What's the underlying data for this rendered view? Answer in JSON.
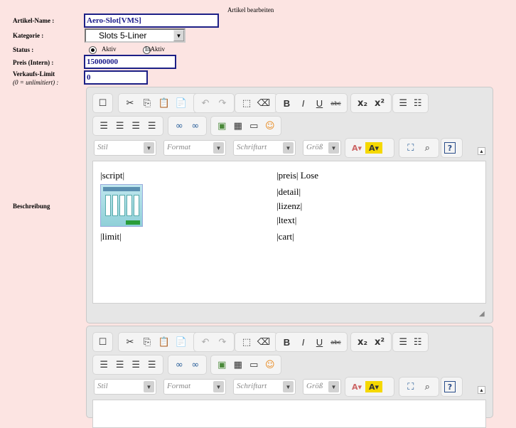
{
  "page": {
    "heading": "Artikel bearbeiten"
  },
  "form": {
    "name_label": "Artikel-Name :",
    "name_value": "Aero-Slot[VMS]",
    "category_label": "Kategorie :",
    "category_value": "Slots 5-Liner",
    "status_label": "Status :",
    "status_options": [
      {
        "label": "Aktiv",
        "selected": true
      },
      {
        "label": "InAktiv",
        "selected": false
      }
    ],
    "price_label": "Preis (Intern) :",
    "price_value": "15000000",
    "limit_label": "Verkaufs-Limit",
    "limit_sub": "(0 = unlimitiert) :",
    "limit_value": "0",
    "description_label": "Beschreibung"
  },
  "editor": {
    "format_placeholders": [
      "Stil",
      "Format",
      "Schriftart",
      "Größ"
    ],
    "content": {
      "left": [
        "|script|",
        "|limit|"
      ],
      "right": [
        "|preis| Lose",
        "|detail|",
        "|lizenz|",
        "|ltext|",
        "|cart|"
      ]
    }
  },
  "icons": {
    "toolbar1": [
      "new-page-icon",
      "cut-icon",
      "copy-icon",
      "paste-icon",
      "paste-word-icon",
      "undo-icon",
      "redo-icon",
      "select-all-icon",
      "remove-format-icon",
      "bold-icon",
      "italic-icon",
      "underline-icon",
      "strikethrough-icon",
      "subscript-icon",
      "superscript-icon",
      "numbered-list-icon",
      "bulleted-list-icon"
    ],
    "toolbar2": [
      "align-left-icon",
      "align-center-icon",
      "align-right-icon",
      "justify-icon",
      "link-icon",
      "unlink-icon",
      "image-icon",
      "table-icon",
      "horizontal-rule-icon",
      "smiley-icon"
    ],
    "toolbar3": [
      "text-color-icon",
      "background-color-icon",
      "maximize-icon",
      "show-blocks-icon",
      "help-icon"
    ]
  }
}
